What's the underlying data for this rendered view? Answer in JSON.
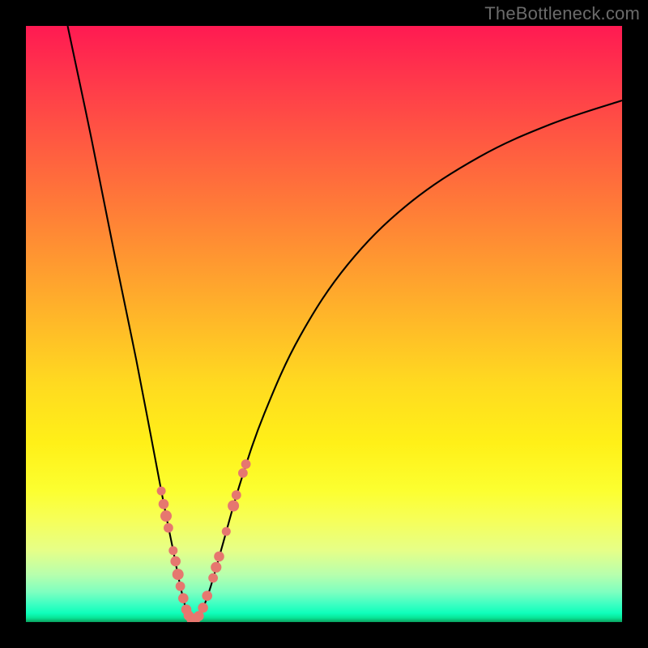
{
  "watermark": "TheBottleneck.com",
  "colors": {
    "frame": "#000000",
    "gradient_top": "#ff1a52",
    "gradient_bottom": "#0aa05e",
    "curve": "#000000",
    "marker": "#e6776f"
  },
  "chart_data": {
    "type": "line",
    "title": "",
    "xlabel": "",
    "ylabel": "",
    "xlim": [
      0,
      100
    ],
    "ylim": [
      0,
      100
    ],
    "note": "V-shaped bottleneck curve; no axis ticks shown — values are read as percent of plot area width/height (origin bottom-left).",
    "series": [
      {
        "name": "bottleneck-curve",
        "points": [
          {
            "x": 7.0,
            "y": 100.0
          },
          {
            "x": 11.0,
            "y": 81.0
          },
          {
            "x": 15.0,
            "y": 61.0
          },
          {
            "x": 18.5,
            "y": 44.0
          },
          {
            "x": 21.0,
            "y": 31.0
          },
          {
            "x": 23.0,
            "y": 20.5
          },
          {
            "x": 24.6,
            "y": 12.5
          },
          {
            "x": 25.8,
            "y": 6.5
          },
          {
            "x": 26.8,
            "y": 2.4
          },
          {
            "x": 27.6,
            "y": 0.6
          },
          {
            "x": 28.6,
            "y": 0.6
          },
          {
            "x": 29.6,
            "y": 2.1
          },
          {
            "x": 31.0,
            "y": 6.0
          },
          {
            "x": 33.0,
            "y": 13.0
          },
          {
            "x": 36.0,
            "y": 23.5
          },
          {
            "x": 40.0,
            "y": 35.0
          },
          {
            "x": 46.0,
            "y": 48.0
          },
          {
            "x": 54.0,
            "y": 60.0
          },
          {
            "x": 64.0,
            "y": 70.0
          },
          {
            "x": 76.0,
            "y": 78.0
          },
          {
            "x": 88.0,
            "y": 83.5
          },
          {
            "x": 100.0,
            "y": 87.5
          }
        ]
      }
    ],
    "markers": [
      {
        "x": 22.7,
        "y": 22.0,
        "r": 0.75
      },
      {
        "x": 23.1,
        "y": 19.8,
        "r": 0.85
      },
      {
        "x": 23.5,
        "y": 17.8,
        "r": 0.95
      },
      {
        "x": 23.9,
        "y": 15.8,
        "r": 0.8
      },
      {
        "x": 24.7,
        "y": 12.0,
        "r": 0.75
      },
      {
        "x": 25.1,
        "y": 10.2,
        "r": 0.85
      },
      {
        "x": 25.5,
        "y": 8.0,
        "r": 0.95
      },
      {
        "x": 25.9,
        "y": 6.0,
        "r": 0.8
      },
      {
        "x": 26.4,
        "y": 4.0,
        "r": 0.85
      },
      {
        "x": 26.9,
        "y": 2.1,
        "r": 0.85
      },
      {
        "x": 27.3,
        "y": 1.1,
        "r": 0.85
      },
      {
        "x": 27.8,
        "y": 0.55,
        "r": 0.9
      },
      {
        "x": 28.4,
        "y": 0.55,
        "r": 0.9
      },
      {
        "x": 29.0,
        "y": 1.0,
        "r": 0.85
      },
      {
        "x": 29.7,
        "y": 2.4,
        "r": 0.85
      },
      {
        "x": 30.4,
        "y": 4.4,
        "r": 0.85
      },
      {
        "x": 31.4,
        "y": 7.4,
        "r": 0.8
      },
      {
        "x": 31.9,
        "y": 9.2,
        "r": 0.9
      },
      {
        "x": 32.4,
        "y": 11.0,
        "r": 0.85
      },
      {
        "x": 33.6,
        "y": 15.2,
        "r": 0.75
      },
      {
        "x": 34.8,
        "y": 19.5,
        "r": 0.95
      },
      {
        "x": 35.3,
        "y": 21.3,
        "r": 0.8
      },
      {
        "x": 36.4,
        "y": 25.0,
        "r": 0.8
      },
      {
        "x": 36.9,
        "y": 26.5,
        "r": 0.8
      }
    ]
  }
}
